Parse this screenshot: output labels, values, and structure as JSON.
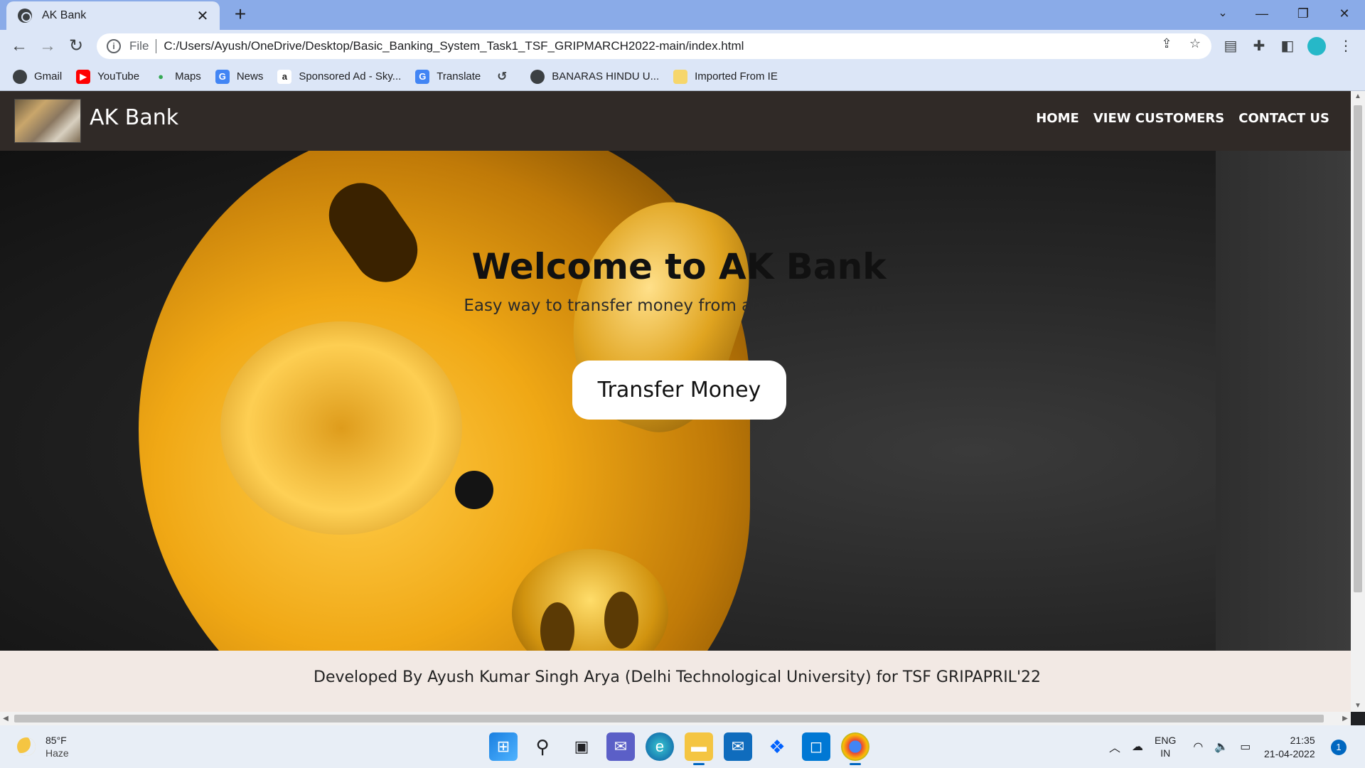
{
  "browser": {
    "tab_title": "AK Bank",
    "tab_close": "✕",
    "new_tab": "+",
    "scheme": "File",
    "url": "C:/Users/Ayush/OneDrive/Desktop/Basic_Banking_System_Task1_TSF_GRIPMARCH2022-main/index.html",
    "window_controls": {
      "tab_search": "⌄",
      "minimize": "—",
      "restore": "❐",
      "close": "✕"
    },
    "nav": {
      "back": "←",
      "forward": "→",
      "reload": "↻",
      "menu": "⋮"
    },
    "bookmarks": [
      {
        "label": "Gmail",
        "icon": "globe-icon",
        "color": "#3c4043",
        "glyph": ""
      },
      {
        "label": "YouTube",
        "icon": "youtube-icon",
        "color": "#ff0000",
        "glyph": "▶"
      },
      {
        "label": "Maps",
        "icon": "maps-pin-icon",
        "color": "#34a853",
        "glyph": "●"
      },
      {
        "label": "News",
        "icon": "news-icon",
        "color": "#4285f4",
        "glyph": "G"
      },
      {
        "label": "Sponsored Ad - Sky...",
        "icon": "amazon-icon",
        "color": "#222222",
        "glyph": "a"
      },
      {
        "label": "Translate",
        "icon": "translate-icon",
        "color": "#4285f4",
        "glyph": "G"
      },
      {
        "label": "",
        "icon": "history-icon",
        "color": "#5f6368",
        "glyph": "↺"
      },
      {
        "label": "BANARAS HINDU U...",
        "icon": "globe-icon",
        "color": "#3c4043",
        "glyph": ""
      },
      {
        "label": "Imported From IE",
        "icon": "folder-icon",
        "color": "#f6d66b",
        "glyph": ""
      }
    ]
  },
  "site": {
    "brand": "AK Bank",
    "nav_links": [
      "HOME",
      "VIEW CUSTOMERS",
      "CONTACT US"
    ],
    "hero_title": "Welcome to AK Bank",
    "hero_subtitle": "Easy way to transfer money from anywhere anytime",
    "cta_label": "Transfer Money",
    "footer_text": "Developed By Ayush Kumar Singh Arya (Delhi Technological University) for TSF GRIPAPRIL'22"
  },
  "taskbar": {
    "weather_temp": "85°F",
    "weather_condition": "Haze",
    "lang_line1": "ENG",
    "lang_line2": "IN",
    "time": "21:35",
    "date": "21-04-2022",
    "notification_count": "1"
  },
  "colors": {
    "site_nav_bg": "#302a27",
    "footer_bg": "#f2e9e4",
    "chrome_accent": "#8aabe8"
  }
}
